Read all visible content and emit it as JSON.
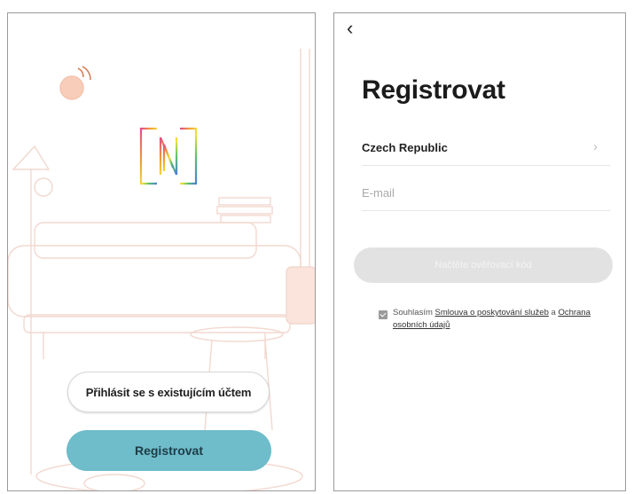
{
  "start_screen": {
    "logo_letter": "N",
    "login_button_label": "Přihlásit se s existujícím účtem",
    "register_button_label": "Registrovat"
  },
  "register_screen": {
    "back_icon": "chevron-left-icon",
    "title": "Registrovat",
    "country": "Czech Republic",
    "country_chevron": "chevron-right-icon",
    "email_placeholder": "E-mail",
    "email_value": "",
    "get_code_button_label": "Načtěte ověřovací kód",
    "consent_checked": true,
    "consent_prefix": "Souhlasím",
    "terms_link": "Smlouva o poskytování služeb",
    "consent_conjunction": "a",
    "privacy_link": "Ochrana osobních údajů"
  },
  "colors": {
    "register_button": "#6fbccb",
    "disabled_button": "#e2e2e2",
    "illustration_line": "#f2d8cf",
    "lamp_shade": "#f8cdb9"
  }
}
